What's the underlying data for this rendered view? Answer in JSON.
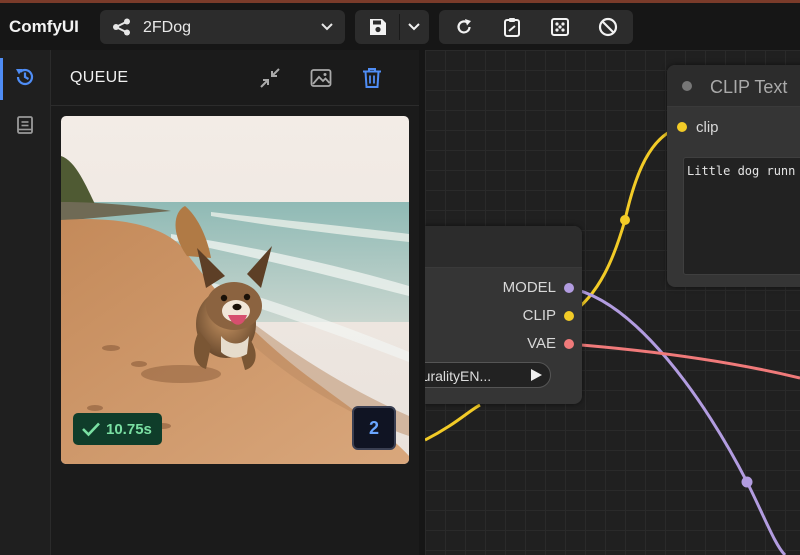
{
  "app": {
    "title": "ComfyUI"
  },
  "workflow": {
    "name": "2FDog"
  },
  "sidebar": {
    "items": [
      {
        "icon": "history-icon",
        "active": true
      },
      {
        "icon": "book-icon",
        "active": false
      }
    ]
  },
  "queue": {
    "title": "QUEUE",
    "items": [
      {
        "duration": "10.75s",
        "output_count": "2",
        "status": "success"
      }
    ]
  },
  "canvas": {
    "loader_node": {
      "outputs": [
        "MODEL",
        "CLIP",
        "VAE"
      ],
      "checkpoint_value": "ruralityEN..."
    },
    "clip_node": {
      "title": "CLIP Text",
      "input": "clip",
      "prompt": "Little dog runn"
    }
  },
  "colors": {
    "accent": "#4f8df5",
    "success": "#7ae0a3",
    "wire_clip": "#f2cb27",
    "wire_model": "#b29ce0",
    "wire_vae": "#f07a7a"
  }
}
